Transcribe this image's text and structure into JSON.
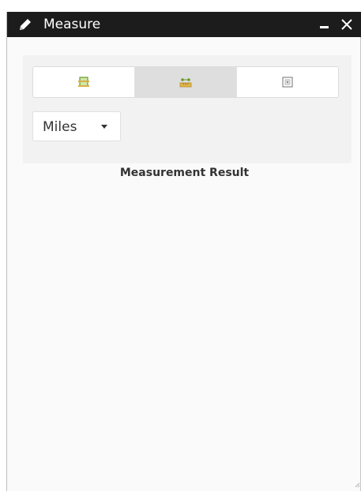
{
  "window": {
    "title": "Measure",
    "title_icon": "pencil-icon",
    "minimize_icon": "minimize-icon",
    "close_icon": "close-icon"
  },
  "tools": [
    {
      "name": "area",
      "icon": "area-measure-icon",
      "active": false
    },
    {
      "name": "distance",
      "icon": "distance-measure-icon",
      "active": true
    },
    {
      "name": "location",
      "icon": "location-measure-icon",
      "active": false
    }
  ],
  "unit_select": {
    "selected": "Miles"
  },
  "result": {
    "title": "Measurement Result"
  },
  "colors": {
    "titlebar_bg": "#1c1c1c",
    "panel_bg": "#fafafa",
    "tools_area_bg": "#f2f2f2",
    "active_tool_bg": "#dedede"
  }
}
